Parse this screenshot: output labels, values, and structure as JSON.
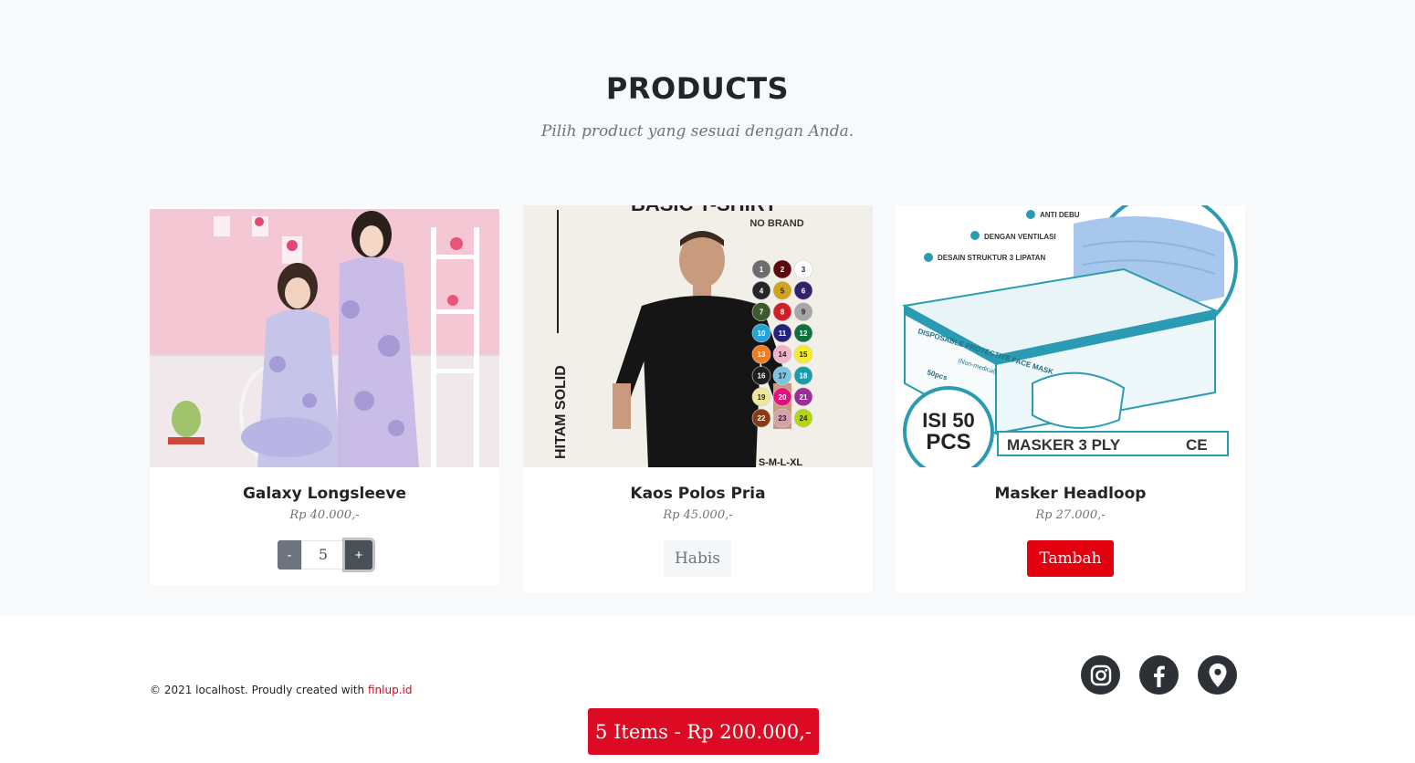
{
  "section": {
    "title": "PRODUCTS",
    "subtitle": "Pilih product yang sesuai dengan Anda."
  },
  "products": [
    {
      "name": "Galaxy Longsleeve",
      "price": "Rp 40.000,-",
      "image": "woman-pajamas-photo",
      "quantity": "5",
      "minus_label": "-",
      "plus_label": "+"
    },
    {
      "name": "Kaos Polos Pria",
      "price": "Rp 45.000,-",
      "image": "man-tshirt-photo",
      "image_text": {
        "heading": "BASIC T-SHIRT",
        "brand": "NO BRAND",
        "side_label": "HITAM SOLID",
        "sizes": "S-M-L-XL",
        "color_numbers": [
          "1",
          "2",
          "3",
          "4",
          "5",
          "6",
          "7",
          "8",
          "9",
          "10",
          "11",
          "12",
          "13",
          "14",
          "15",
          "16",
          "17",
          "18",
          "19",
          "20",
          "21",
          "22",
          "23",
          "24"
        ]
      },
      "status_label": "Habis"
    },
    {
      "name": "Masker Headloop",
      "price": "Rp 27.000,-",
      "image": "face-mask-box-photo",
      "image_text": {
        "feature_1": "ANTI DEBU",
        "feature_2": "DENGAN VENTILASI",
        "feature_3": "DESAIN STRUKTUR 3 LIPATAN",
        "box_label": "DISPOSABLE PROTECTIVE FACE MASK",
        "box_sublabel": "(Non-medical)",
        "count_line_1": "ISI 50",
        "count_line_2": "PCS",
        "banner": "MASKER 3 PLY",
        "mark": "CE",
        "box_badge": "50pcs"
      },
      "add_label": "Tambah"
    }
  ],
  "footer": {
    "copyright": "© 2021 localhost. Proudly created with ",
    "link_text": "finlup.id",
    "social_icons": [
      "instagram-icon",
      "facebook-icon",
      "map-marker-icon"
    ]
  },
  "cart": {
    "label": "5 Items - Rp 200.000,-"
  },
  "colors": {
    "accent": "#e3000f",
    "section_bg": "#f8f9fa",
    "social_bg": "#2d3136",
    "tshirt_swatches": [
      "#6d6d6d",
      "#5c0a12",
      "#ffffff",
      "#262626",
      "#d1a21a",
      "#33216b",
      "#3c5a2c",
      "#d21f26",
      "#a7a7a7",
      "#22a3d9",
      "#24227a",
      "#10703d",
      "#f47a1c",
      "#f5b3c7",
      "#f6ec27",
      "#1e1e1e",
      "#7fc4de",
      "#1c9bab",
      "#efe89a",
      "#e4117d",
      "#9d2b9a",
      "#8a3a12",
      "#d7a0a9",
      "#b5d414"
    ]
  }
}
